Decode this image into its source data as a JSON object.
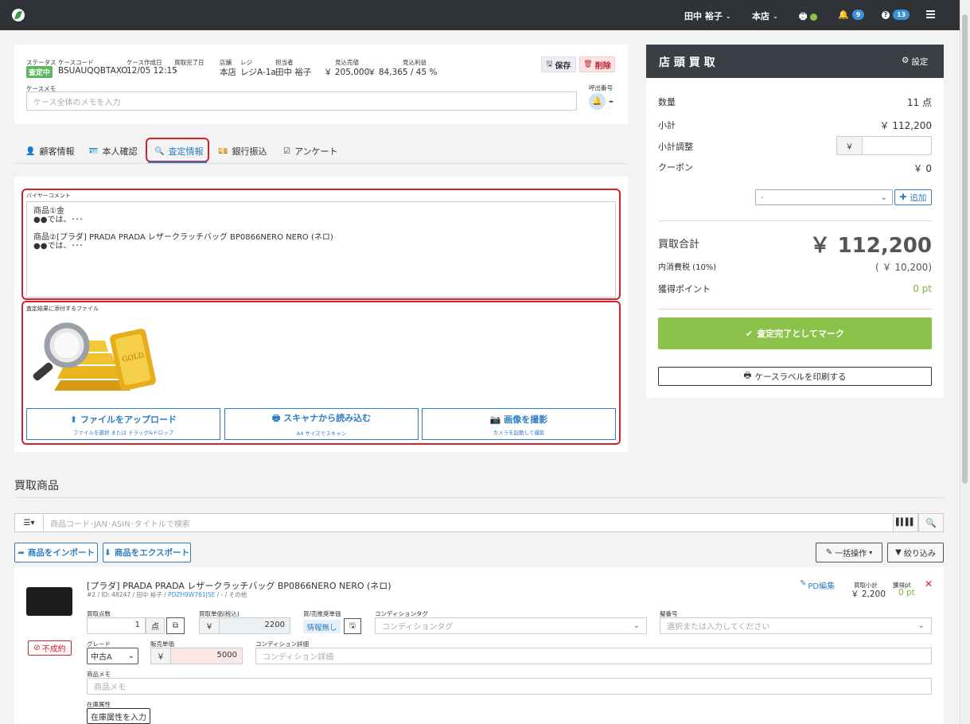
{
  "topbar": {
    "user": "田中 裕子",
    "store": "本店",
    "notifications": "9",
    "help": "13"
  },
  "case": {
    "labels": {
      "status": "ステータス",
      "case_code": "ケースコード",
      "created": "ケース作成日",
      "completed": "買取完了日",
      "store": "店舗",
      "register": "レジ",
      "staff": "担当者",
      "expected_sales": "見込売値",
      "expected_profit": "見込利益",
      "memo": "ケースメモ",
      "call_number": "呼出番号"
    },
    "status": "査定中",
    "case_code": "BSUAUQQBTAXO",
    "created": "12/05 12:15",
    "completed": "-",
    "store": "本店",
    "register": "レジA-1a",
    "staff": "田中 裕子",
    "expected_sales": "￥ 205,000",
    "expected_profit": "￥ 84,365 / 45 %",
    "memo_placeholder": "ケース全体のメモを入力",
    "call_number": "–",
    "save": "保存",
    "delete": "削除"
  },
  "tabs": [
    "顧客情報",
    "本人確認",
    "査定情報",
    "銀行振込",
    "アンケート"
  ],
  "appraisal": {
    "buyer_comment_label": "バイヤーコメント",
    "buyer_comment_lines": [
      "商品①金",
      "●●では、･･･",
      "",
      "商品②[プラダ] PRADA PRADA レザークラッチバッグ BP0866NERO NERO (ネロ)",
      "●●では、･･･"
    ],
    "files_label": "査定結果に添付するファイル",
    "image_label": "GOLD",
    "upload": {
      "title": "ファイルをアップロード",
      "sub": "ファイルを選択 または ドラッグ&ドロップ"
    },
    "scan": {
      "title": "スキャナから読み込む",
      "sub": "A4 サイズでスキャン"
    },
    "camera": {
      "title": "画像を撮影",
      "sub": "カメラを起動して撮影"
    }
  },
  "summary": {
    "title": "店 頭 買 取",
    "settings": "設定",
    "qty_label": "数量",
    "qty": "11 点",
    "subtotal_label": "小計",
    "subtotal": "￥ 112,200",
    "adjust_label": "小計調整",
    "yen": "￥",
    "coupon_label": "クーポン",
    "coupon": "￥ 0",
    "coupon_select": "-",
    "add": "追加",
    "total_label": "買取合計",
    "total": "￥ 112,200",
    "tax_label": "内消費税 (10%)",
    "tax": "( ￥ 10,200)",
    "points_label": "獲得ポイント",
    "points": "0 pt",
    "complete": "査定完了としてマーク",
    "print": "ケースラベルを印刷する"
  },
  "items_section": {
    "title": "買取商品",
    "search_placeholder": "商品コード･JAN･ASIN･タイトルで検索",
    "import": "商品をインポート",
    "export": "商品をエクスポート",
    "bulk": "一括操作",
    "filter": "絞り込み"
  },
  "item": {
    "title": "[プラダ] PRADA PRADA レザークラッチバッグ BP0866NERO NERO (ネロ)",
    "meta_prefix": "#2 / ID: 48247 / 田中 裕子 / ",
    "meta_code": "PDZH9W761JSE",
    "meta_suffix": " / - / その他",
    "pd_edit": "PD編集",
    "subtotal_label": "買取小計",
    "subtotal": "￥ 2,200",
    "points_label": "獲得pt",
    "points": "0 pt",
    "failed": "不成約",
    "qty_label": "買取点数",
    "qty": "1",
    "qty_unit": "点",
    "unit_price_label": "買取単価(税込)",
    "unit_price": "2200",
    "ref_price_label": "買/売推奨単価",
    "no_info": "情報無し",
    "condition_tag_label": "コンディションタグ",
    "condition_tag_placeholder": "コンディションタグ",
    "serial_label": "擬番号",
    "serial_placeholder": "選択または入力してください",
    "grade_label": "グレード",
    "grade": "中古A",
    "sale_price_label": "販売単価",
    "sale_price": "5000",
    "condition_detail_label": "コンディション詳細",
    "condition_detail_placeholder": "コンディション詳細",
    "memo_label": "商品メモ",
    "memo_placeholder": "商品メモ",
    "stock_label": "在庫属性",
    "stock_button": "在庫属性を入力"
  },
  "colors": {
    "topbar": "#2f3338",
    "accent_blue": "#2f7dc2",
    "green": "#8bc34a",
    "red": "#d9202a",
    "status_green": "#5cb85c"
  }
}
